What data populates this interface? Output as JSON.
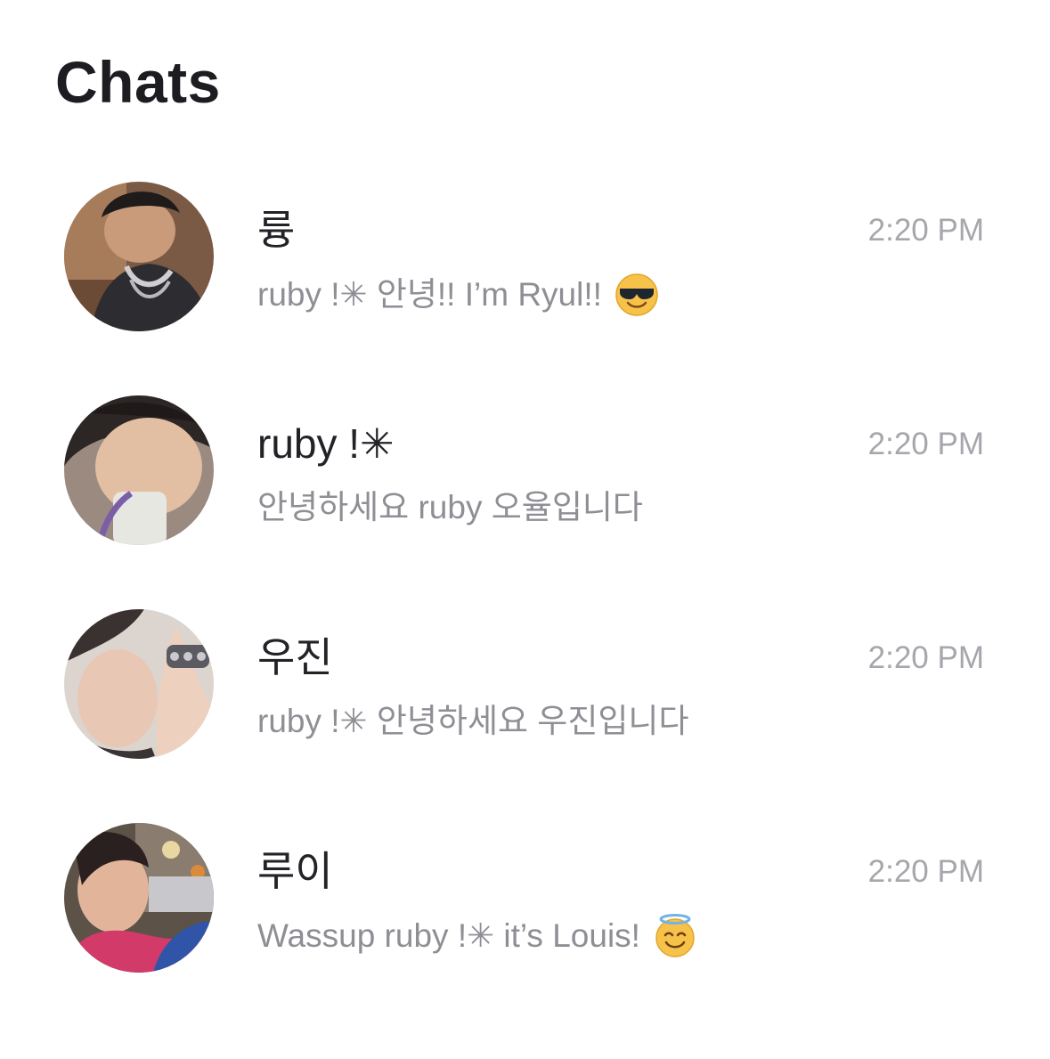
{
  "header": {
    "title": "Chats"
  },
  "chats": [
    {
      "name": "륭",
      "time": "2:20 PM",
      "preview": "ruby !✳ 안녕!! I’m Ryul!!",
      "emoji_icon": "smiling-face-with-sunglasses-icon",
      "avatar_colors": [
        "#6b4f3a",
        "#2a2a2c",
        "#c9a27e"
      ]
    },
    {
      "name": "ruby !✳",
      "time": "2:20 PM",
      "preview": "안녕하세요 ruby 오율입니다",
      "avatar_colors": [
        "#8a7a70",
        "#e8c9b0",
        "#d7d7d2"
      ]
    },
    {
      "name": "우진",
      "time": "2:20 PM",
      "preview": "ruby !✳ 안녕하세요 우진입니다",
      "avatar_colors": [
        "#d8cfca",
        "#3a3434",
        "#e6c6b2"
      ]
    },
    {
      "name": "루이",
      "time": "2:20 PM",
      "preview": "Wassup ruby !✳ it’s Louis!",
      "emoji_icon": "smiling-face-with-halo-icon",
      "avatar_colors": [
        "#2d4a8a",
        "#d23a6a",
        "#e1b49a"
      ]
    }
  ]
}
